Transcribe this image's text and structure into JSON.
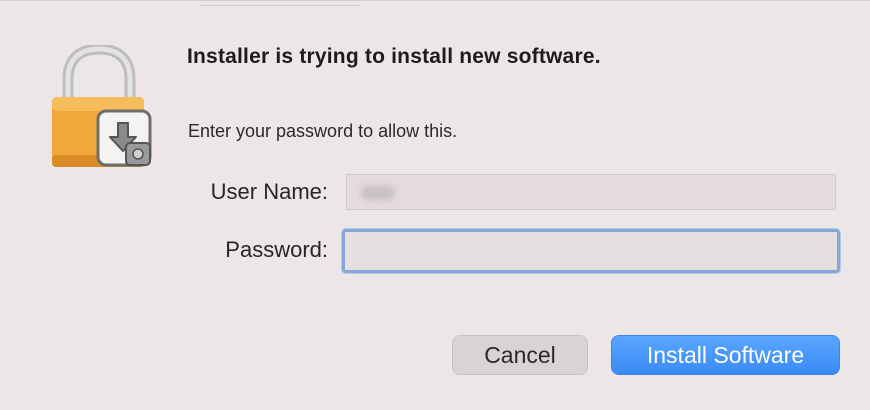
{
  "dialog": {
    "title": "Installer is trying to install new software.",
    "message": "Enter your password to allow this.",
    "user_name_label": "User Name:",
    "password_label": "Password:",
    "user_name_value": "",
    "password_value": "",
    "cancel_label": "Cancel",
    "install_label": "Install Software"
  },
  "icons": {
    "lock": "lock-icon",
    "installer_badge": "installer-download-icon"
  },
  "colors": {
    "background": "#ece6e6",
    "accent": "#3a8af7",
    "lock_gold": "#f0a83a",
    "focus_ring": "#8aa6d8"
  }
}
